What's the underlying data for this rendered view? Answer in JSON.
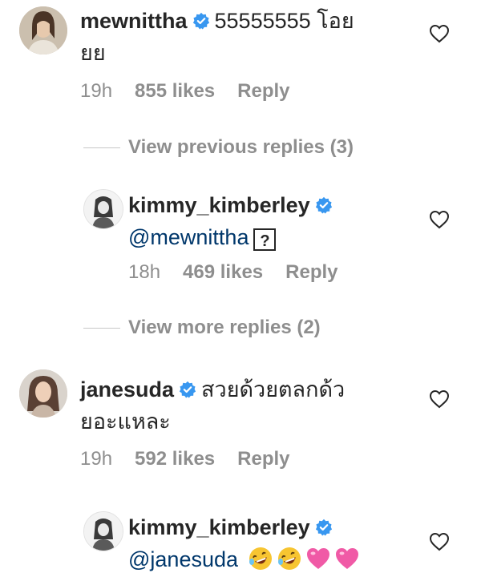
{
  "comments": [
    {
      "username": "mewnittha",
      "text": "55555555 โอย",
      "text_line2": "ยย",
      "time": "19h",
      "likes": "855 likes",
      "reply": "Reply"
    },
    {
      "view_link": "View previous replies (3)"
    },
    {
      "username": "kimmy_kimberley",
      "mention": "@mewnittha",
      "qbox": "?",
      "time": "18h",
      "likes": "469 likes",
      "reply": "Reply"
    },
    {
      "view_link": "View more replies (2)"
    },
    {
      "username": "janesuda",
      "text": "สวยด้วยตลกด้ว",
      "text_line2": "ยอะแหละ",
      "time": "19h",
      "likes": "592 likes",
      "reply": "Reply"
    },
    {
      "username": "kimmy_kimberley",
      "mention": "@janesuda"
    }
  ],
  "colors": {
    "verified": "#3897f0",
    "mention": "#00376b",
    "meta": "#8e8e8e",
    "heart_emoji": "#f05aa6",
    "laugh_emoji": "#f7c531"
  }
}
